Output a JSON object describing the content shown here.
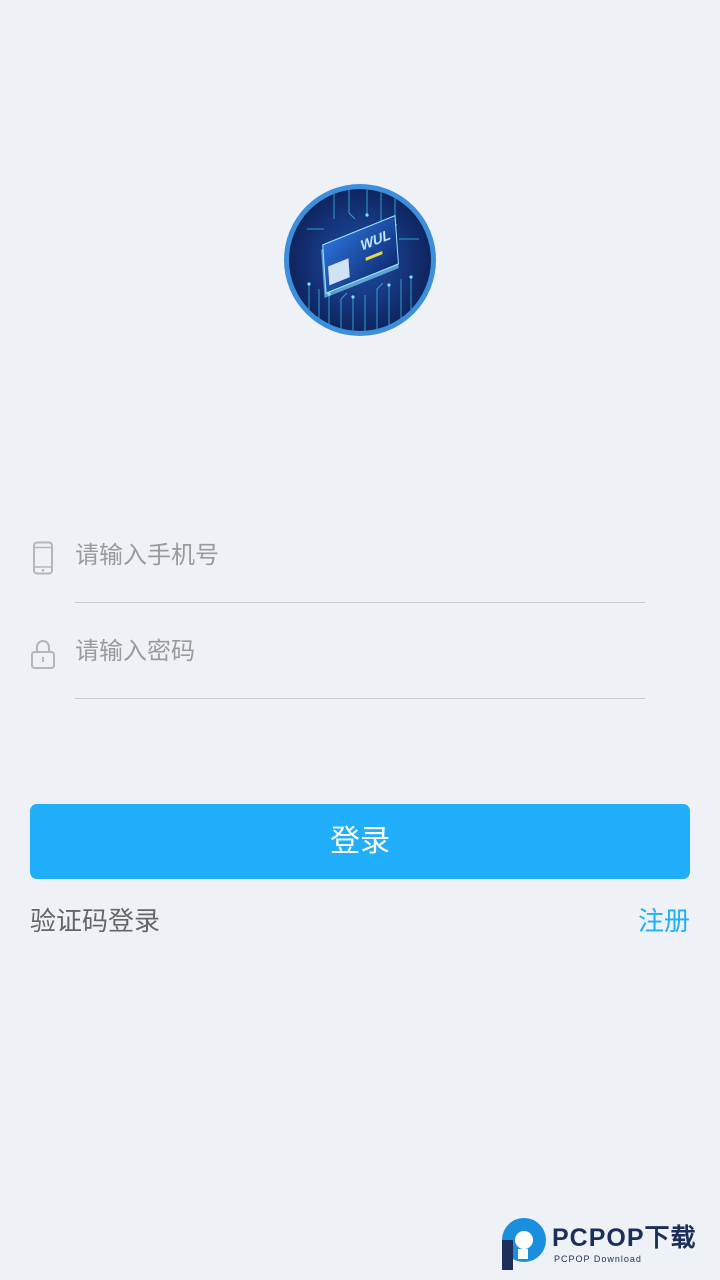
{
  "logo": {
    "icon": "app-logo-icon"
  },
  "login_form": {
    "phone": {
      "placeholder": "请输入手机号",
      "value": "",
      "icon": "phone-icon"
    },
    "password": {
      "placeholder": "请输入密码",
      "value": "",
      "icon": "lock-icon"
    },
    "login_button": "登录",
    "sms_login_link": "验证码登录",
    "register_link": "注册"
  },
  "watermark": {
    "title": "PCPOP下载",
    "subtitle": "PCPOP Download"
  },
  "colors": {
    "background": "#eef2f6",
    "accent": "#21aefa",
    "secondary_text": "#666666",
    "placeholder": "#9a9a9a",
    "logo_ring": "#3d8fdc"
  }
}
